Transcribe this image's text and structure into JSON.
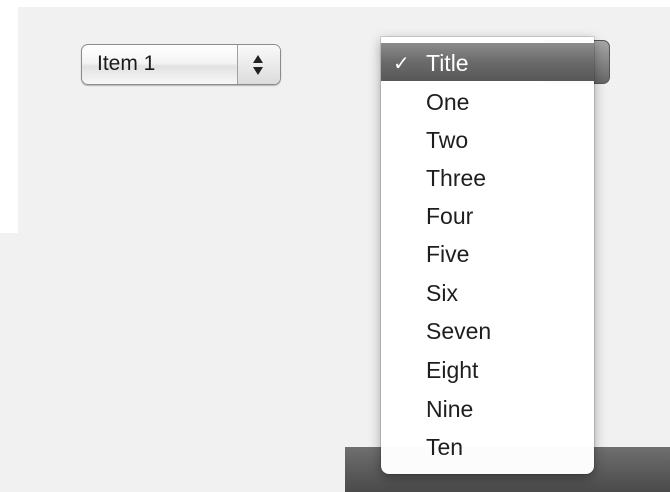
{
  "popup_left": {
    "value": "Item 1",
    "icon": "up-down-arrows-icon"
  },
  "menu": {
    "check_glyph": "✓",
    "items": [
      {
        "label": "Title",
        "selected": true
      },
      {
        "label": "One"
      },
      {
        "label": "Two"
      },
      {
        "label": "Three"
      },
      {
        "label": "Four"
      },
      {
        "label": "Five"
      },
      {
        "label": "Six"
      },
      {
        "label": "Seven"
      },
      {
        "label": "Eight"
      },
      {
        "label": "Nine"
      },
      {
        "label": "Ten"
      }
    ]
  }
}
